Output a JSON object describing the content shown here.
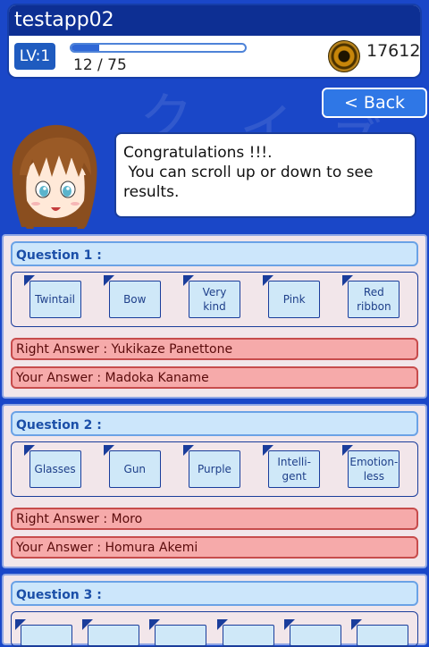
{
  "app": {
    "title": "testapp02",
    "level_label": "LV:1",
    "progress_text": "12 / 75",
    "progress_fraction": 0.16,
    "coins": "17612"
  },
  "nav": {
    "back_label": "< Back"
  },
  "message": {
    "lines": [
      "Congratulations !!!.",
      " You can scroll up or down to see",
      "results."
    ]
  },
  "questions": [
    {
      "title": "Question 1 :",
      "choices": [
        "Twintail",
        "Bow",
        "Very\nkind",
        "Pink",
        "Red\nribbon"
      ],
      "right_answer": "Right Answer : Yukikaze Panettone",
      "your_answer": "Your Answer : Madoka Kaname"
    },
    {
      "title": "Question 2 :",
      "choices": [
        "Glasses",
        "Gun",
        "Purple",
        "Intelli-\ngent",
        "Emotion-\nless"
      ],
      "right_answer": "Right Answer : Moro",
      "your_answer": "Your Answer : Homura Akemi"
    },
    {
      "title": "Question 3 :",
      "choices": []
    }
  ],
  "colors": {
    "background": "#1a47c8",
    "header_bar": "#0d2f93",
    "accent": "#2f77e6",
    "wrong": "#f6aaaa"
  }
}
